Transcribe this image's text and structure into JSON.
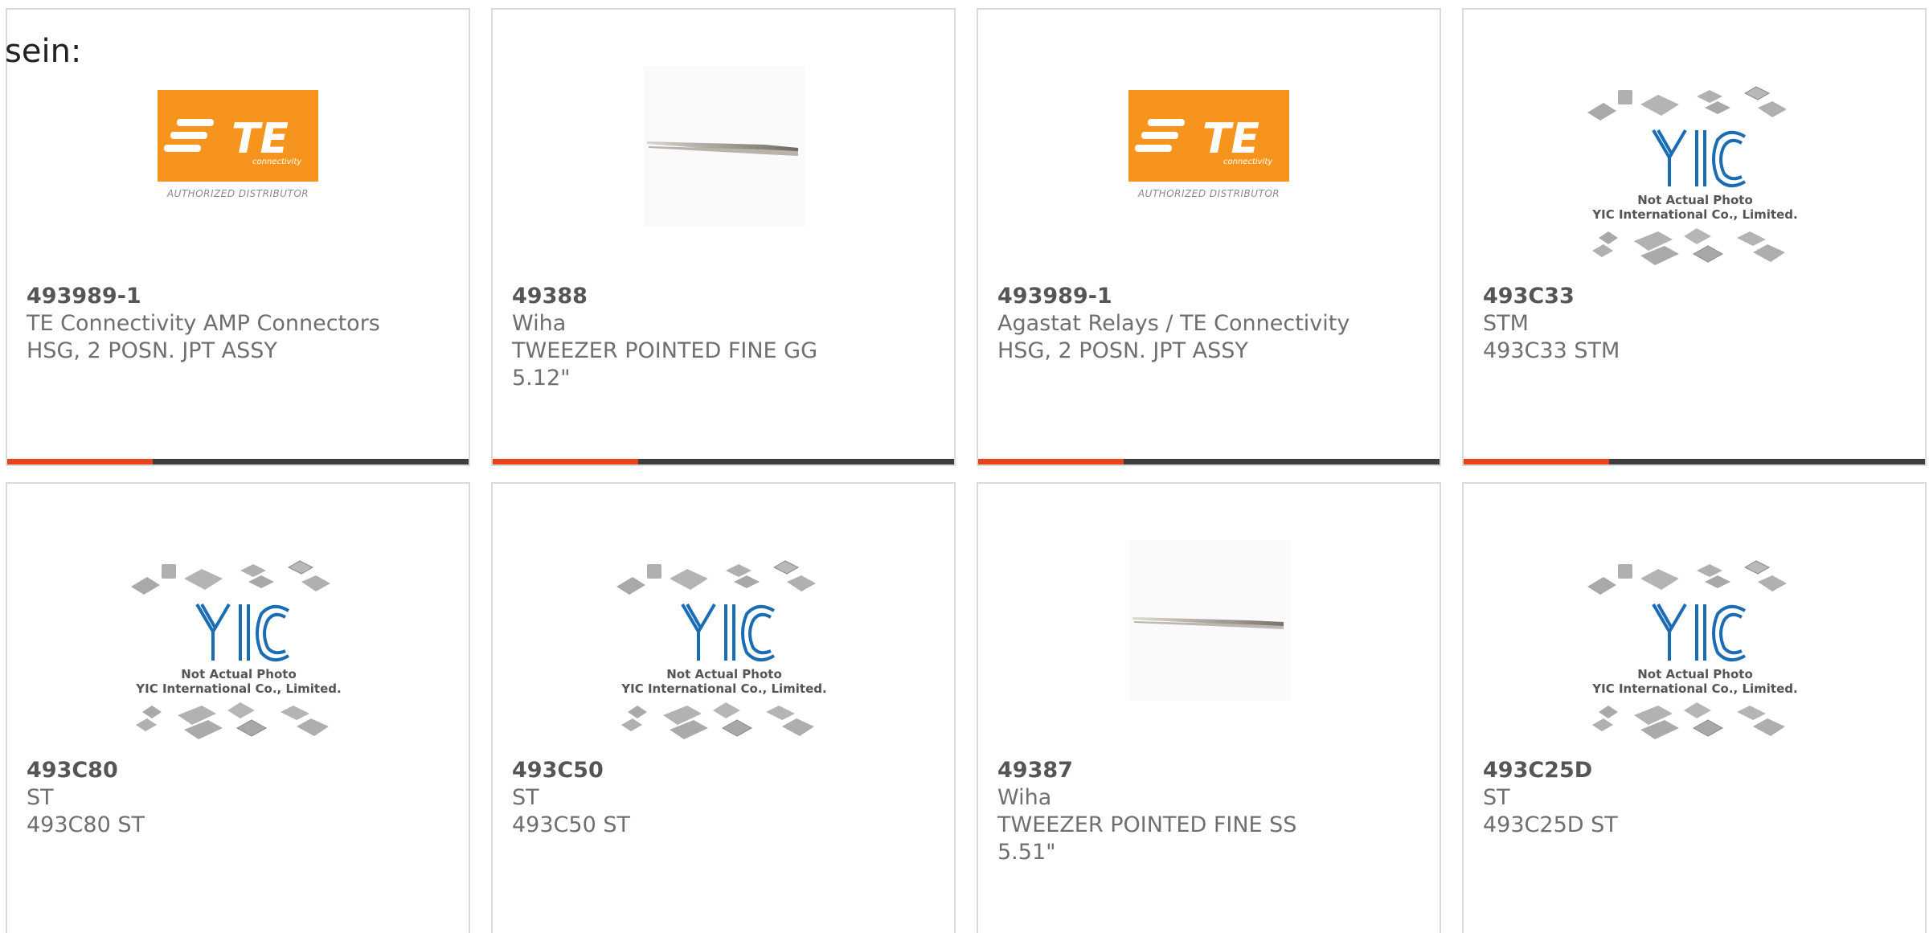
{
  "intro": {
    "text": "sein:"
  },
  "products": [
    {
      "part_number": "493989-1",
      "manufacturer": "TE Connectivity AMP Connectors",
      "description": "HSG, 2 POSN. JPT ASSY",
      "image": "te-logo",
      "logo_text": "TE",
      "logo_subtext": "connectivity",
      "logo_caption": "AUTHORIZED DISTRIBUTOR"
    },
    {
      "part_number": "49388",
      "manufacturer": "Wiha",
      "description": "TWEEZER POINTED FINE GG 5.12\"",
      "image": "tweezer-photo"
    },
    {
      "part_number": "493989-1",
      "manufacturer": "Agastat Relays / TE Connectivity",
      "description": "HSG, 2 POSN. JPT ASSY",
      "image": "te-logo",
      "logo_text": "TE",
      "logo_subtext": "connectivity",
      "logo_caption": "AUTHORIZED DISTRIBUTOR"
    },
    {
      "part_number": "493C33",
      "manufacturer": "STM",
      "description": "493C33 STM",
      "image": "yic-placeholder",
      "caption_line1": "Not Actual Photo",
      "caption_line2": "YIC International Co., Limited."
    },
    {
      "part_number": "493C80",
      "manufacturer": "ST",
      "description": "493C80 ST",
      "image": "yic-placeholder",
      "caption_line1": "Not Actual Photo",
      "caption_line2": "YIC International Co., Limited."
    },
    {
      "part_number": "493C50",
      "manufacturer": "ST",
      "description": "493C50 ST",
      "image": "yic-placeholder",
      "caption_line1": "Not Actual Photo",
      "caption_line2": "YIC International Co., Limited."
    },
    {
      "part_number": "49387",
      "manufacturer": "Wiha",
      "description": "TWEEZER POINTED FINE SS 5.51\"",
      "image": "tweezer-photo"
    },
    {
      "part_number": "493C25D",
      "manufacturer": "ST",
      "description": "493C25D ST",
      "image": "yic-placeholder",
      "caption_line1": "Not Actual Photo",
      "caption_line2": "YIC International Co., Limited."
    }
  ],
  "colors": {
    "accent": "#e8421b",
    "bar": "#3d3d3d",
    "te_orange": "#f7941d",
    "yic_blue": "#1a6db5"
  }
}
